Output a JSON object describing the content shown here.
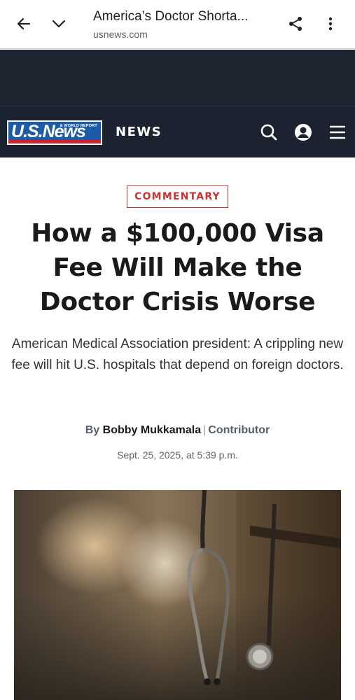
{
  "browser": {
    "title": "America’s Doctor Shorta...",
    "url": "usnews.com"
  },
  "site": {
    "logo_text": "U.S.News",
    "logo_subtext": "& WORLD REPORT",
    "section_label": "NEWS"
  },
  "article": {
    "tag": "COMMENTARY",
    "headline": "How a $100,000 Visa Fee Will Make the Doctor Crisis Worse",
    "dek": "American Medical Association president: A crippling new fee will hit U.S. hospitals that depend on foreign doctors.",
    "byline_prefix": "By",
    "author": "Bobby Mukkamala",
    "byline_separator": "|",
    "author_role": "Contributor",
    "date": "Sept. 25, 2025, at 5:39 p.m."
  },
  "colors": {
    "header_bg": "#1b2330",
    "tag_red": "#c8342f",
    "logo_blue": "#1d5ba8"
  },
  "icons": [
    "back-arrow-icon",
    "chevron-down-icon",
    "share-icon",
    "more-vert-icon",
    "search-icon",
    "account-icon",
    "menu-icon"
  ]
}
